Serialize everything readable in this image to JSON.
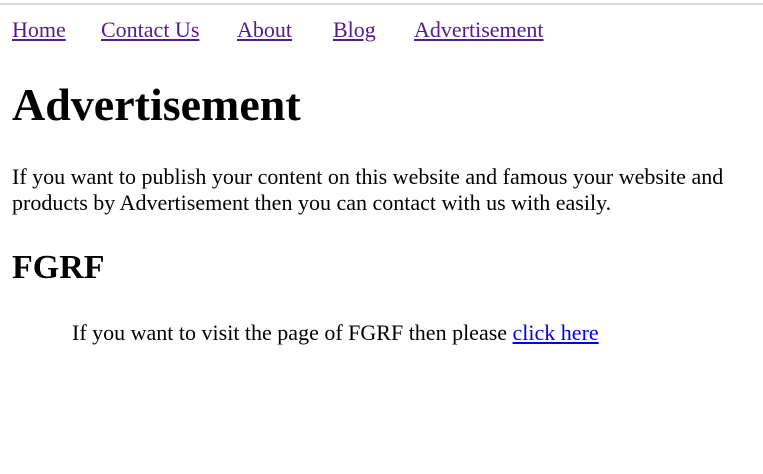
{
  "nav": {
    "items": [
      {
        "label": "Home"
      },
      {
        "label": "Contact Us"
      },
      {
        "label": "About"
      },
      {
        "label": "Blog"
      },
      {
        "label": "Advertisement"
      }
    ],
    "link_color": "#551a8b"
  },
  "main": {
    "title": "Advertisement",
    "intro": "If you want to publish your content on this website and famous your website and products by Advertisement then you can contact with us with easily.",
    "section_title": "FGRF",
    "visit_text": "If you want to visit the page of FGRF then please ",
    "visit_link": "click here",
    "link_color": "#0000ee"
  }
}
